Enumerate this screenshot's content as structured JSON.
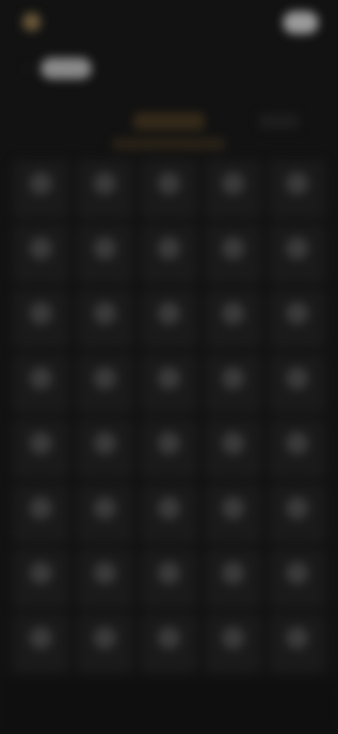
{
  "header": {
    "brand_name": "",
    "action_label": ""
  },
  "toolbar": {
    "back_pill_label": ""
  },
  "section": {
    "title": "",
    "subtitle": "",
    "link": ""
  },
  "grid": {
    "rows": 8,
    "columns": 5,
    "tiles": [
      {
        "label": ""
      },
      {
        "label": ""
      },
      {
        "label": ""
      },
      {
        "label": ""
      },
      {
        "label": ""
      },
      {
        "label": ""
      },
      {
        "label": ""
      },
      {
        "label": ""
      },
      {
        "label": ""
      },
      {
        "label": ""
      },
      {
        "label": ""
      },
      {
        "label": ""
      },
      {
        "label": ""
      },
      {
        "label": ""
      },
      {
        "label": ""
      },
      {
        "label": ""
      },
      {
        "label": ""
      },
      {
        "label": ""
      },
      {
        "label": ""
      },
      {
        "label": ""
      },
      {
        "label": ""
      },
      {
        "label": ""
      },
      {
        "label": ""
      },
      {
        "label": ""
      },
      {
        "label": ""
      },
      {
        "label": ""
      },
      {
        "label": ""
      },
      {
        "label": ""
      },
      {
        "label": ""
      },
      {
        "label": ""
      },
      {
        "label": ""
      },
      {
        "label": ""
      },
      {
        "label": ""
      },
      {
        "label": ""
      },
      {
        "label": ""
      },
      {
        "label": ""
      },
      {
        "label": ""
      },
      {
        "label": ""
      },
      {
        "label": ""
      },
      {
        "label": ""
      }
    ]
  },
  "icons": {
    "brand": "logo-icon",
    "back": "chevron-left-icon",
    "tile": "item-icon"
  },
  "colors": {
    "background": "#121212",
    "accent": "#8a6a2a",
    "tile": "#1a1a1a",
    "button": "#9a9a9a"
  }
}
